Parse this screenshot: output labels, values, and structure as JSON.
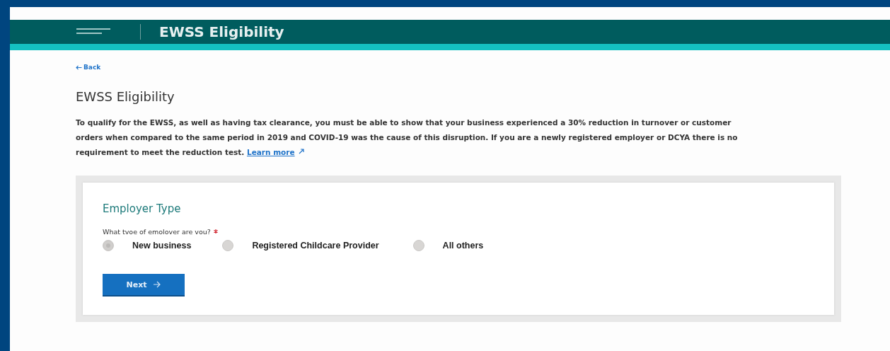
{
  "header": {
    "title": "EWSS Eligibility"
  },
  "back_link": "Back",
  "page_title": "EWSS Eligibility",
  "intro": {
    "text": "To qualify for the EWSS, as well as having tax clearance, you must be able to show that your business experienced a 30% reduction in turnover or customer orders when compared to the same period in 2019 and COVID-19 was the cause of this disruption. If you are a newly registered employer or DCYA there is no requirement to meet the reduction test.",
    "link": "Learn more"
  },
  "form": {
    "heading": "Employer Type",
    "question": "What tvoe of emolover are vou?",
    "required": true,
    "options": [
      {
        "label": "New business",
        "selected": true
      },
      {
        "label": "Registered  Childcare Provider",
        "selected": false
      },
      {
        "label": "All others",
        "selected": false
      }
    ],
    "button": "Next"
  }
}
